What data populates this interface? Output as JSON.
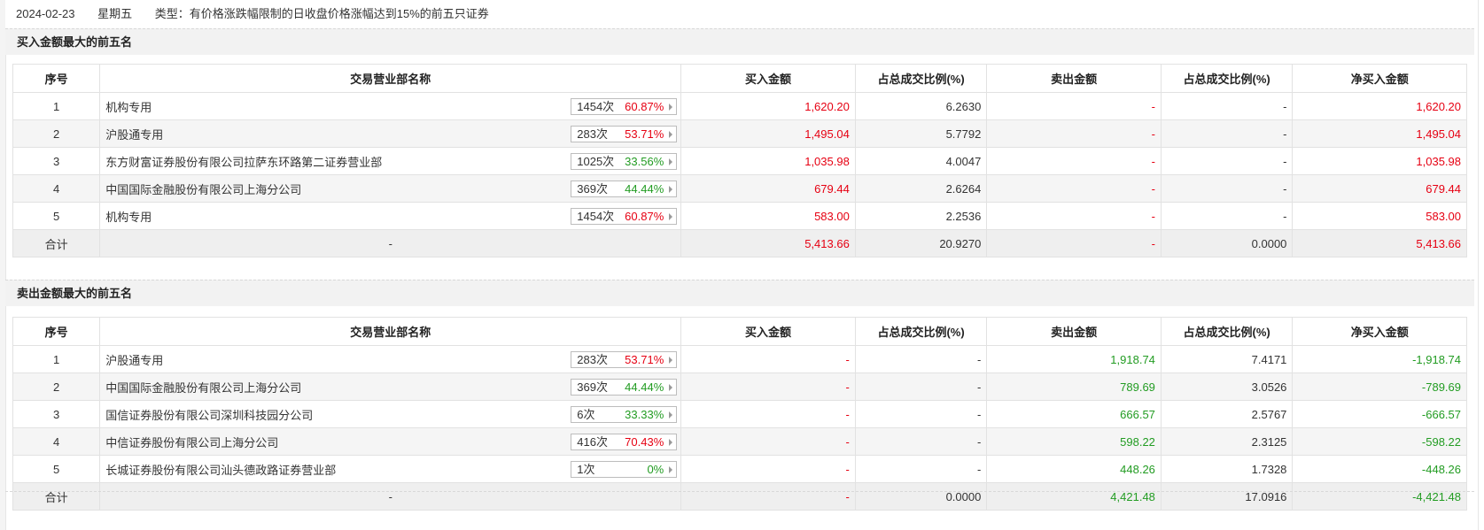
{
  "info": {
    "date": "2024-02-23",
    "weekday": "星期五",
    "type_label": "类型：",
    "type_value": "有价格涨跌幅限制的日收盘价格涨幅达到15%的前五只证券"
  },
  "colors": {
    "up": "#e60012",
    "down": "#229c22"
  },
  "columns": [
    "序号",
    "交易营业部名称",
    "买入金额",
    "占总成交比例(%)",
    "卖出金额",
    "占总成交比例(%)",
    "净买入金额"
  ],
  "buy": {
    "title": "买入金额最大的前五名",
    "rows": [
      {
        "no": "1",
        "name": "机构专用",
        "count": "1454次",
        "pct": "60.87%",
        "pct_color": "red",
        "buy": "1,620.20",
        "buy_ratio": "6.2630",
        "sell": "-",
        "sell_ratio": "-",
        "net": "1,620.20"
      },
      {
        "no": "2",
        "name": "沪股通专用",
        "count": "283次",
        "pct": "53.71%",
        "pct_color": "red",
        "buy": "1,495.04",
        "buy_ratio": "5.7792",
        "sell": "-",
        "sell_ratio": "-",
        "net": "1,495.04"
      },
      {
        "no": "3",
        "name": "东方财富证券股份有限公司拉萨东环路第二证券营业部",
        "count": "1025次",
        "pct": "33.56%",
        "pct_color": "green",
        "buy": "1,035.98",
        "buy_ratio": "4.0047",
        "sell": "-",
        "sell_ratio": "-",
        "net": "1,035.98"
      },
      {
        "no": "4",
        "name": "中国国际金融股份有限公司上海分公司",
        "count": "369次",
        "pct": "44.44%",
        "pct_color": "green",
        "buy": "679.44",
        "buy_ratio": "2.6264",
        "sell": "-",
        "sell_ratio": "-",
        "net": "679.44"
      },
      {
        "no": "5",
        "name": "机构专用",
        "count": "1454次",
        "pct": "60.87%",
        "pct_color": "red",
        "buy": "583.00",
        "buy_ratio": "2.2536",
        "sell": "-",
        "sell_ratio": "-",
        "net": "583.00"
      }
    ],
    "total": {
      "label": "合计",
      "name": "-",
      "buy": "5,413.66",
      "buy_ratio": "20.9270",
      "sell": "-",
      "sell_ratio": "0.0000",
      "net": "5,413.66"
    }
  },
  "sell": {
    "title": "卖出金额最大的前五名",
    "rows": [
      {
        "no": "1",
        "name": "沪股通专用",
        "count": "283次",
        "pct": "53.71%",
        "pct_color": "red",
        "buy": "-",
        "buy_ratio": "-",
        "sell": "1,918.74",
        "sell_ratio": "7.4171",
        "net": "-1,918.74"
      },
      {
        "no": "2",
        "name": "中国国际金融股份有限公司上海分公司",
        "count": "369次",
        "pct": "44.44%",
        "pct_color": "green",
        "buy": "-",
        "buy_ratio": "-",
        "sell": "789.69",
        "sell_ratio": "3.0526",
        "net": "-789.69"
      },
      {
        "no": "3",
        "name": "国信证券股份有限公司深圳科技园分公司",
        "count": "6次",
        "pct": "33.33%",
        "pct_color": "green",
        "buy": "-",
        "buy_ratio": "-",
        "sell": "666.57",
        "sell_ratio": "2.5767",
        "net": "-666.57"
      },
      {
        "no": "4",
        "name": "中信证券股份有限公司上海分公司",
        "count": "416次",
        "pct": "70.43%",
        "pct_color": "red",
        "buy": "-",
        "buy_ratio": "-",
        "sell": "598.22",
        "sell_ratio": "2.3125",
        "net": "-598.22"
      },
      {
        "no": "5",
        "name": "长城证券股份有限公司汕头德政路证券营业部",
        "count": "1次",
        "pct": "0%",
        "pct_color": "green",
        "buy": "-",
        "buy_ratio": "-",
        "sell": "448.26",
        "sell_ratio": "1.7328",
        "net": "-448.26"
      }
    ],
    "total": {
      "label": "合计",
      "name": "-",
      "buy": "-",
      "buy_ratio": "0.0000",
      "sell": "4,421.48",
      "sell_ratio": "17.0916",
      "net": "-4,421.48"
    }
  }
}
